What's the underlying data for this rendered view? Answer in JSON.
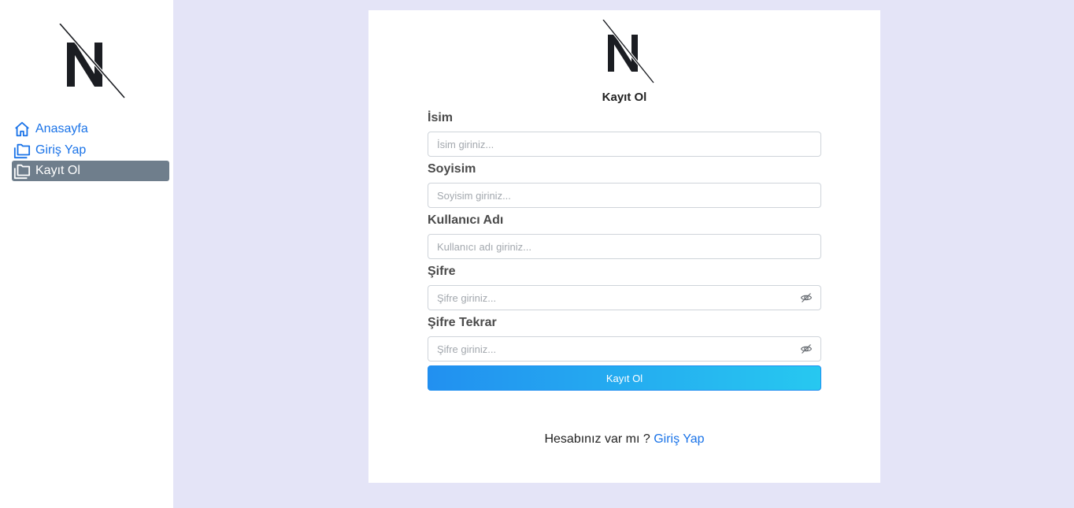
{
  "sidebar": {
    "logo": "logo",
    "items": [
      {
        "label": "Anasayfa",
        "icon": "home-icon",
        "active": false
      },
      {
        "label": "Giriş Yap",
        "icon": "folders-icon",
        "active": false
      },
      {
        "label": "Kayıt Ol",
        "icon": "folders-icon",
        "active": true
      }
    ]
  },
  "form": {
    "title": "Kayıt Ol",
    "fields": [
      {
        "label": "İsim",
        "placeholder": "İsim giriniz...",
        "type": "text"
      },
      {
        "label": "Soyisim",
        "placeholder": "Soyisim giriniz...",
        "type": "text"
      },
      {
        "label": "Kullanıcı Adı",
        "placeholder": "Kullanıcı adı giriniz...",
        "type": "text"
      },
      {
        "label": "Şifre",
        "placeholder": "Şifre giriniz...",
        "type": "password"
      },
      {
        "label": "Şifre Tekrar",
        "placeholder": "Şifre giriniz...",
        "type": "password"
      }
    ],
    "submit_label": "Kayıt Ol"
  },
  "footer": {
    "prompt": "Hesabınız var mı ? ",
    "link": "Giriş Yap"
  },
  "colors": {
    "background": "#e4e4f7",
    "link": "#1a73e8",
    "active_nav": "#6f7e8c",
    "button_start": "#2290f0",
    "button_end": "#27c8f0"
  }
}
